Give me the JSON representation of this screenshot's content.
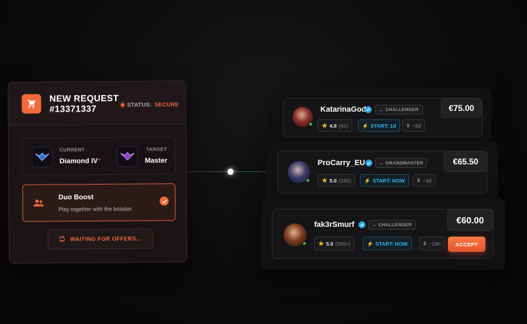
{
  "request": {
    "title_line1": "NEW REQUEST",
    "title_line2": "#13371337",
    "status_label": "STATUS:",
    "status_value": "SECURE",
    "current_label": "CURRENT",
    "current_rank": "Diamond IV",
    "target_label": "TARGET",
    "target_rank": "Master",
    "option_title": "Duo Boost",
    "option_desc": "Play together with the booster.",
    "waiting_label": "WAITING FOR OFFERS..."
  },
  "offers": [
    {
      "name": "KatarinaGod",
      "tier": "CHALLENGER",
      "rating": "4.8",
      "reviews": "(42)",
      "start": "START: 1d",
      "eta": "~5d",
      "price": "€75.00"
    },
    {
      "name": "ProCarry_EU",
      "tier": "GRANDMASTER",
      "rating": "5.0",
      "reviews": "(150)",
      "start": "START: NOW",
      "eta": "~3d",
      "price": "€65.50"
    },
    {
      "name": "fak3rSmurf",
      "tier": "CHALLENGER",
      "rating": "5.0",
      "reviews": "(500+)",
      "start": "START: NOW",
      "eta": "~18h",
      "price": "€60.00",
      "action": "ACCEPT"
    }
  ],
  "colors": {
    "accent": "#f26a3c",
    "start_blue": "#36b3ea",
    "online_green": "#37c25a",
    "star_gold": "#f5b52a"
  },
  "icons": {
    "cart": "cart-icon",
    "arrow": "arrow-right-icon",
    "duo": "users-icon",
    "check": "check-icon",
    "refresh": "refresh-icon",
    "verified": "verified-icon",
    "star": "star-icon",
    "bolt": "bolt-icon",
    "hourglass": "hourglass-icon"
  }
}
